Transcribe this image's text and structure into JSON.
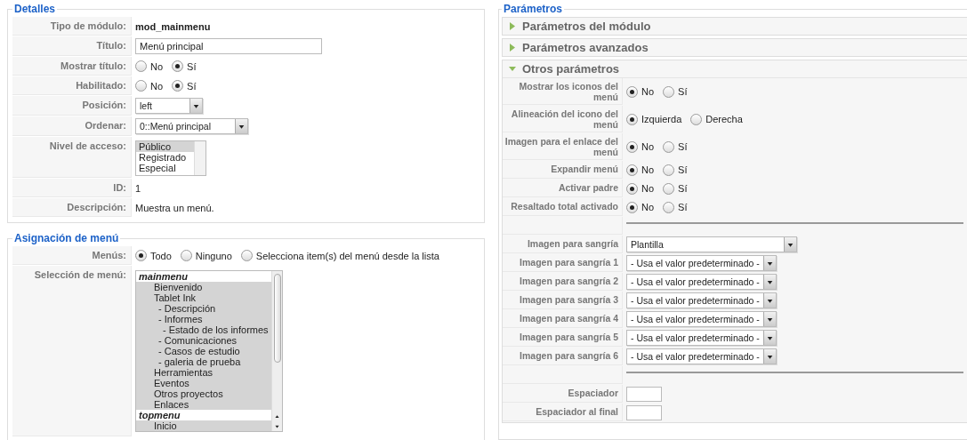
{
  "details": {
    "legend": "Detalles",
    "rows": [
      {
        "kind": "strong",
        "label": "Tipo de módulo:",
        "value": "mod_mainmenu"
      },
      {
        "kind": "input",
        "label": "Título:",
        "value": "Menú principal"
      },
      {
        "kind": "radio",
        "label": "Mostrar título:",
        "options": [
          {
            "label": "No",
            "selected": false
          },
          {
            "label": "Sí",
            "selected": true
          }
        ]
      },
      {
        "kind": "radio",
        "label": "Habilitado:",
        "options": [
          {
            "label": "No",
            "selected": false
          },
          {
            "label": "Sí",
            "selected": true
          }
        ]
      },
      {
        "kind": "select",
        "label": "Posición:",
        "value": "left"
      },
      {
        "kind": "select",
        "label": "Ordenar:",
        "value": "0::Menú principal"
      },
      {
        "kind": "listbox",
        "label": "Nivel de acceso:",
        "items": [
          {
            "label": "Público",
            "selected": true
          },
          {
            "label": "Registrado",
            "selected": false
          },
          {
            "label": "Especial",
            "selected": false
          }
        ]
      },
      {
        "kind": "plain",
        "label": "ID:",
        "value": "1"
      },
      {
        "kind": "plain",
        "label": "Descripción:",
        "value": "Muestra un menú."
      }
    ]
  },
  "menu_assignment": {
    "legend": "Asignación de menú",
    "rows": [
      {
        "kind": "radio",
        "label": "Menús:",
        "options": [
          {
            "label": "Todo",
            "selected": true
          },
          {
            "label": "Ninguno",
            "selected": false
          },
          {
            "label": "Selecciona item(s) del menú desde la lista",
            "selected": false
          }
        ]
      },
      {
        "kind": "tree",
        "label": "Selección de menú:",
        "groups": [
          {
            "label": "mainmenu",
            "items": [
              {
                "label": "Bienvenido",
                "selected": true
              },
              {
                "label": "Tablet Ink",
                "selected": true,
                "children": [
                  {
                    "label": "- Descripción",
                    "selected": true
                  },
                  {
                    "label": "- Informes",
                    "selected": true,
                    "children": [
                      {
                        "label": "- Estado de los informes",
                        "selected": true
                      }
                    ]
                  },
                  {
                    "label": "- Comunicaciones",
                    "selected": true
                  },
                  {
                    "label": "- Casos de estudio",
                    "selected": true
                  },
                  {
                    "label": "- galeria de prueba",
                    "selected": true
                  }
                ]
              },
              {
                "label": "Herramientas",
                "selected": true
              },
              {
                "label": "Eventos",
                "selected": true
              },
              {
                "label": "Otros proyectos",
                "selected": true
              },
              {
                "label": "Enlaces",
                "selected": true
              }
            ]
          },
          {
            "label": "topmenu",
            "items": [
              {
                "label": "Inicio",
                "selected": true
              }
            ]
          }
        ]
      }
    ]
  },
  "parameters": {
    "legend": "Parámetros",
    "panels": [
      {
        "title": "Parámetros del módulo",
        "expanded": false
      },
      {
        "title": "Parámetros avanzados",
        "expanded": false
      },
      {
        "title": "Otros parámetros",
        "expanded": true,
        "rows": [
          {
            "kind": "radio",
            "label": "Mostrar los iconos del menú",
            "options": [
              {
                "label": "No",
                "selected": true
              },
              {
                "label": "Sí",
                "selected": false
              }
            ]
          },
          {
            "kind": "radio",
            "label": "Alineación del icono del menú",
            "options": [
              {
                "label": "Izquierda",
                "selected": true
              },
              {
                "label": "Derecha",
                "selected": false
              }
            ]
          },
          {
            "kind": "radio",
            "label": "Imagen para el enlace del menú",
            "options": [
              {
                "label": "No",
                "selected": true
              },
              {
                "label": "Sí",
                "selected": false
              }
            ]
          },
          {
            "kind": "radio",
            "label": "Expandir menú",
            "options": [
              {
                "label": "No",
                "selected": true
              },
              {
                "label": "Sí",
                "selected": false
              }
            ]
          },
          {
            "kind": "radio",
            "label": "Activar padre",
            "options": [
              {
                "label": "No",
                "selected": true
              },
              {
                "label": "Sí",
                "selected": false
              }
            ]
          },
          {
            "kind": "radio",
            "label": "Resaltado total activado",
            "options": [
              {
                "label": "No",
                "selected": true
              },
              {
                "label": "Sí",
                "selected": false
              }
            ]
          },
          {
            "kind": "separator"
          },
          {
            "kind": "select",
            "label": "Imagen para sangría",
            "value": "Plantilla"
          },
          {
            "kind": "select",
            "label": "Imagen para sangría 1",
            "value": "- Usa el valor predeterminado -"
          },
          {
            "kind": "select",
            "label": "Imagen para sangría 2",
            "value": "- Usa el valor predeterminado -"
          },
          {
            "kind": "select",
            "label": "Imagen para sangría 3",
            "value": "- Usa el valor predeterminado -"
          },
          {
            "kind": "select",
            "label": "Imagen para sangría 4",
            "value": "- Usa el valor predeterminado -"
          },
          {
            "kind": "select",
            "label": "Imagen para sangría 5",
            "value": "- Usa el valor predeterminado -"
          },
          {
            "kind": "select",
            "label": "Imagen para sangría 6",
            "value": "- Usa el valor predeterminado -"
          },
          {
            "kind": "separator"
          },
          {
            "kind": "input",
            "label": "Espaciador"
          },
          {
            "kind": "input",
            "label": "Espaciador al final"
          }
        ]
      }
    ]
  }
}
